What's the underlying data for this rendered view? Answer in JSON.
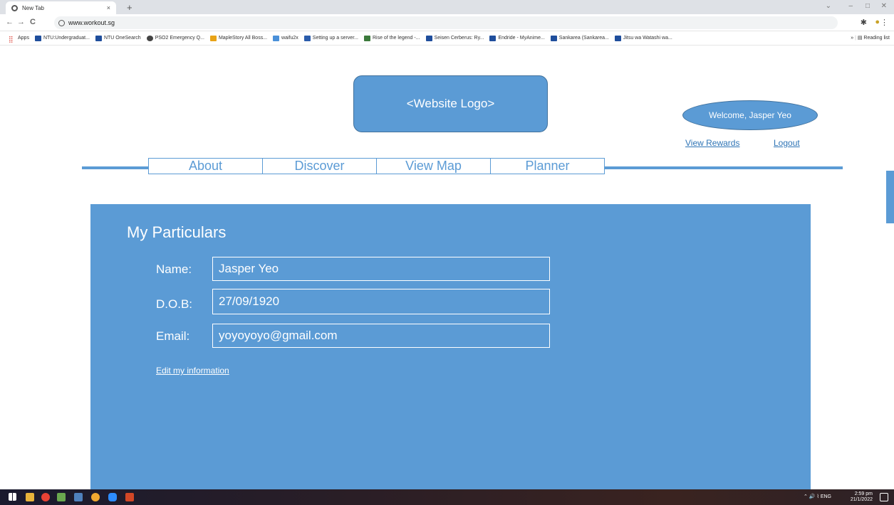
{
  "browser": {
    "tab_title": "New Tab",
    "tab_close": "×",
    "new_tab": "+",
    "url": "www.workout.sg",
    "back_icon": "←",
    "forward_icon": "→",
    "reload_icon": "C",
    "bookmarks": [
      "Apps",
      "NTU:Undergraduat...",
      "NTU OneSearch",
      "PSO2 Emergency Q...",
      "MapleStory All Boss...",
      "waifu2x",
      "Setting up a server...",
      "Rise of the legend -...",
      "Seisen Cerberus: Ry...",
      "Endride - MyAnime...",
      "Sankarea (Sankarea...",
      "Jitsu wa Watashi wa..."
    ],
    "overflow": "»",
    "reading_list": "Reading list"
  },
  "header": {
    "logo": "<Website Logo>",
    "welcome": "Welcome, Jasper Yeo",
    "view_rewards": "View Rewards",
    "logout": "Logout"
  },
  "nav": {
    "items": [
      "About",
      "Discover",
      "View Map",
      "Planner"
    ]
  },
  "particulars": {
    "title": "My Particulars",
    "name_label": "Name:",
    "name_value": "Jasper Yeo",
    "dob_label": "D.O.B:",
    "dob_value": "27/09/1920",
    "email_label": "Email:",
    "email_value": "yoyoyoyo@gmail.com",
    "edit_link": "Edit my information"
  },
  "taskbar": {
    "lang": "ENG",
    "time": "2:59 pm",
    "date": "21/1/2022"
  },
  "colors": {
    "accent": "#5b9bd5",
    "accent_border": "#41719c",
    "link": "#2e74b5"
  }
}
